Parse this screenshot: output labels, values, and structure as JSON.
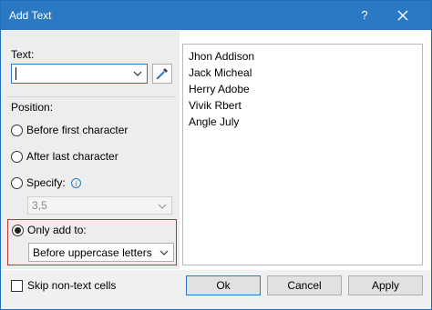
{
  "window": {
    "title": "Add Text",
    "help_label": "?"
  },
  "text_section": {
    "label": "Text:",
    "value": ""
  },
  "position": {
    "label": "Position:",
    "options": [
      "Before first character",
      "After last character",
      "Specify:",
      "Only add to:"
    ],
    "selected": "Only add to:",
    "specify_value": "3,5",
    "only_add_to_value": "Before uppercase letters"
  },
  "list": {
    "items": [
      "Jhon Addison",
      "Jack Micheal",
      "Herry Adobe",
      "Vivik Rbert",
      "Angle July"
    ]
  },
  "footer": {
    "skip_label": "Skip non-text cells",
    "skip_checked": false,
    "ok_label": "Ok",
    "cancel_label": "Cancel",
    "apply_label": "Apply"
  },
  "colors": {
    "titlebar": "#2b79c2",
    "highlight_border": "#b33a3a",
    "accent": "#2b79c2"
  },
  "icons": {
    "close": "close-icon",
    "dropdown": "chevron-down-icon",
    "picker": "eyedropper-icon",
    "info": "info-icon"
  }
}
